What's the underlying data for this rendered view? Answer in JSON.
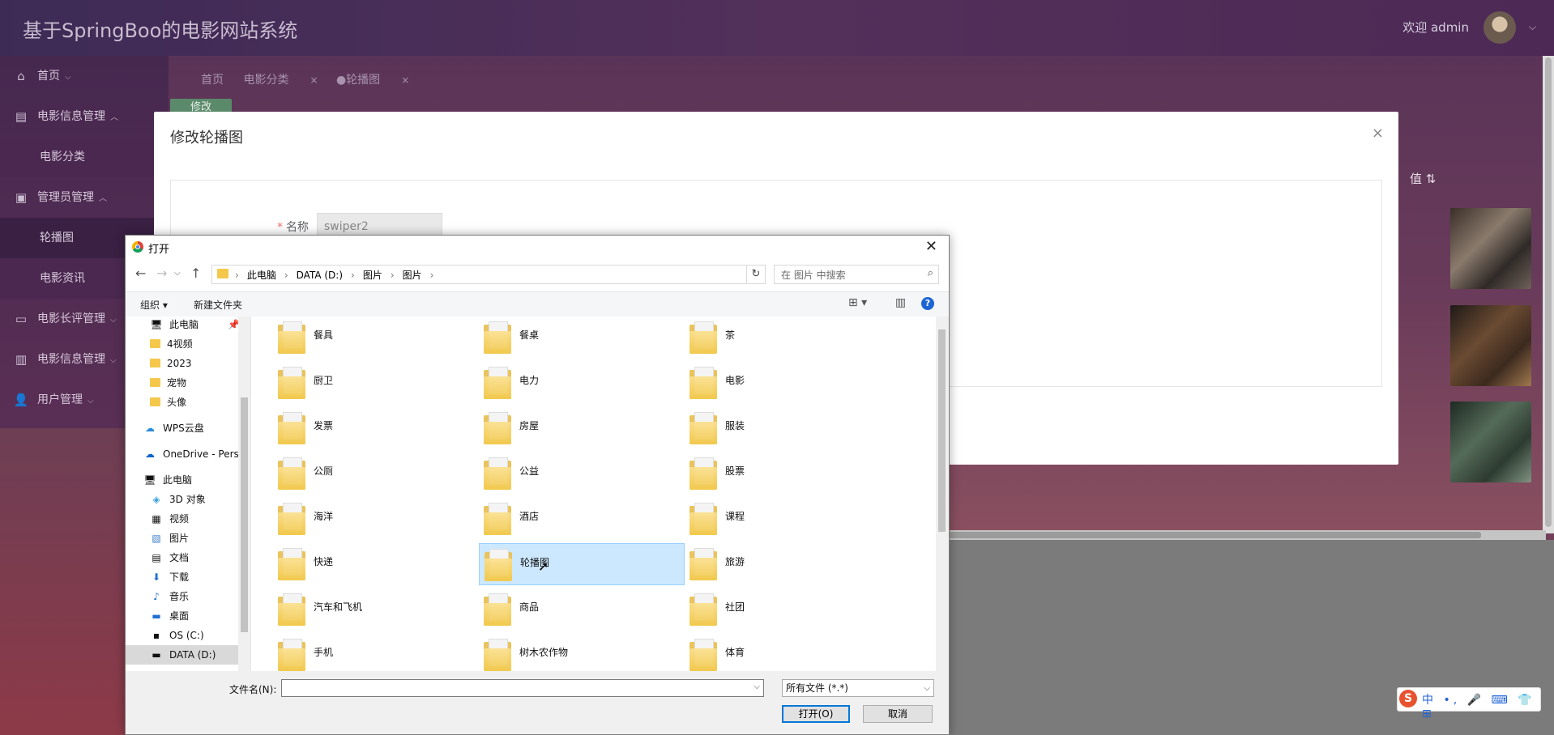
{
  "app": {
    "title": "基于SpringBoo的电影网站系统",
    "welcome": "欢迎 admin"
  },
  "sidebar": {
    "items": [
      {
        "icon": "home-icon",
        "label": "首页"
      },
      {
        "icon": "briefcase-icon",
        "label": "电影信息管理"
      },
      {
        "label": "电影分类"
      },
      {
        "icon": "chip-icon",
        "label": "管理员管理"
      },
      {
        "label": "轮播图"
      },
      {
        "label": "电影资讯"
      },
      {
        "icon": "monitor-icon",
        "label": "电影长评管理"
      },
      {
        "icon": "wallet-icon",
        "label": "电影信息管理"
      },
      {
        "icon": "user-icon",
        "label": "用户管理"
      }
    ]
  },
  "breadcrumb": {
    "items": [
      "首页",
      "电影分类",
      "●轮播图"
    ],
    "close": "×"
  },
  "edit_tab": "修改",
  "table": {
    "value_header": "值 ⇅"
  },
  "modal": {
    "title": "修改轮播图",
    "close": "×",
    "name_label": "名称",
    "required_mark": "*",
    "name_value": "swiper2"
  },
  "dialog": {
    "title": "打开",
    "close": "✕",
    "path": [
      "此电脑",
      "DATA (D:)",
      "图片",
      "图片"
    ],
    "search_placeholder": "在 图片 中搜索",
    "toolbar": {
      "organize": "组织 ▾",
      "new_folder": "新建文件夹",
      "help": "?"
    },
    "nav": [
      {
        "icon": "computer-icon",
        "label": "此电脑"
      },
      {
        "folder": true,
        "label": "4视频"
      },
      {
        "folder": true,
        "label": "2023"
      },
      {
        "folder": true,
        "label": "宠物"
      },
      {
        "folder": true,
        "label": "头像"
      },
      {
        "icon": "cloud-icon",
        "label": "WPS云盘"
      },
      {
        "icon": "onedrive-icon",
        "label": "OneDrive - Personal"
      },
      {
        "icon": "computer-icon",
        "label": "此电脑"
      },
      {
        "icon": "cube-icon",
        "label": "3D 对象"
      },
      {
        "icon": "video-icon",
        "label": "视频"
      },
      {
        "icon": "picture-icon",
        "label": "图片"
      },
      {
        "icon": "document-icon",
        "label": "文档"
      },
      {
        "icon": "download-icon",
        "label": "下载"
      },
      {
        "icon": "music-icon",
        "label": "音乐"
      },
      {
        "icon": "desktop-icon",
        "label": "桌面"
      },
      {
        "icon": "drive-icon",
        "label": "OS (C:)"
      },
      {
        "icon": "drive-icon",
        "label": "DATA (D:)"
      }
    ],
    "folders": [
      "餐具",
      "餐桌",
      "茶",
      "厨卫",
      "电力",
      "电影",
      "发票",
      "房屋",
      "服装",
      "公厕",
      "公益",
      "股票",
      "海洋",
      "酒店",
      "课程",
      "快递",
      "轮播图",
      "旅游",
      "汽车和飞机",
      "商品",
      "社团",
      "手机",
      "树木农作物",
      "体育"
    ],
    "selected_folder": "轮播图",
    "filename_label": "文件名(N):",
    "filename_value": "",
    "filetype": "所有文件 (*.*)",
    "open_button": "打开(O)",
    "cancel_button": "取消"
  },
  "ime": {
    "label": "中 •, 🎤 ⌨ 👕 ⊞"
  }
}
